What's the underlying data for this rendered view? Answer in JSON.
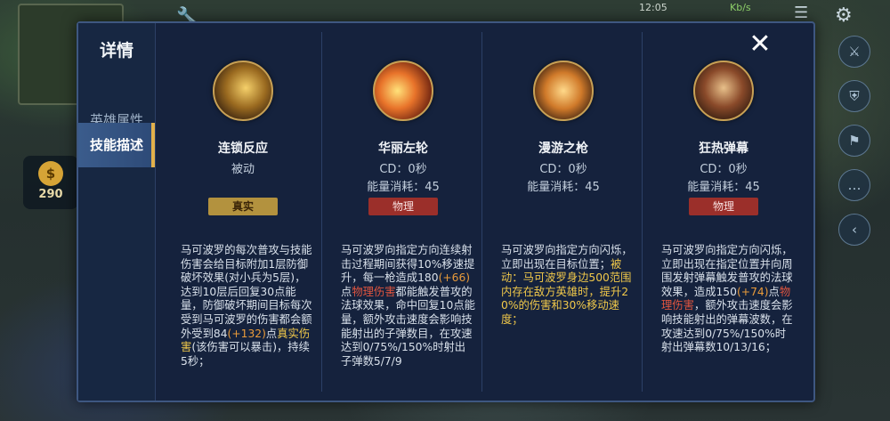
{
  "status": {
    "time": "12:05",
    "network": "Kb/s"
  },
  "gold": {
    "value": "290",
    "icon": "money-bag-icon"
  },
  "panel": {
    "title": "详情",
    "tabs": [
      {
        "label": "英雄属性"
      },
      {
        "label": "技能描述"
      }
    ],
    "active_tab": "技能描述"
  },
  "skills": [
    {
      "name": "连锁反应",
      "line1": "被动",
      "line2": "",
      "tag": "真实",
      "desc_parts": [
        {
          "t": "马可波罗的每次普攻与技能伤害会给目标附加1层防御破坏效果(对小兵为5层)，达到10层后回复30点能量，防御破坏期间目标每次受到马可波罗的伤害都会额外受到84",
          "c": ""
        },
        {
          "t": "(+132)",
          "c": "o"
        },
        {
          "t": "点",
          "c": ""
        },
        {
          "t": "真实伤害",
          "c": "y"
        },
        {
          "t": "(该伤害可以暴击)，持续5秒；",
          "c": ""
        }
      ]
    },
    {
      "name": "华丽左轮",
      "line1": "CD：0秒",
      "line2": "能量消耗：45",
      "tag": "物理",
      "desc_parts": [
        {
          "t": "马可波罗向指定方向连续射击过程期间获得10%移速提升，每一枪造成180",
          "c": ""
        },
        {
          "t": "(+66)",
          "c": "o"
        },
        {
          "t": "点",
          "c": ""
        },
        {
          "t": "物理伤害",
          "c": "r"
        },
        {
          "t": "都能触发普攻的法球效果，命中回复10点能量，额外攻击速度会影响技能射出的子弹数目，在攻速达到0/75%/150%时射出子弹数5/7/9",
          "c": ""
        }
      ]
    },
    {
      "name": "漫游之枪",
      "line1": "CD：0秒",
      "line2": "能量消耗：45",
      "tag": "",
      "desc_parts": [
        {
          "t": "马可波罗向指定方向闪烁，立即出现在目标位置；",
          "c": ""
        },
        {
          "t": "被动：马可波罗身边500范围内存在敌方英雄时，提升20%的伤害和30%移动速度；",
          "c": "y"
        }
      ]
    },
    {
      "name": "狂热弹幕",
      "line1": "CD：0秒",
      "line2": "能量消耗：45",
      "tag": "物理",
      "desc_parts": [
        {
          "t": "马可波罗向指定方向闪烁，立即出现在指定位置并向周围发射弹幕触发普攻的法球效果，造成150",
          "c": ""
        },
        {
          "t": "(+74)",
          "c": "o"
        },
        {
          "t": "点",
          "c": ""
        },
        {
          "t": "物理伤害",
          "c": "r"
        },
        {
          "t": "，额外攻击速度会影响技能射出的弹幕波数，在攻速达到0/75%/150%时射出弹幕数10/13/16；",
          "c": ""
        }
      ]
    }
  ],
  "close_label": "✕"
}
